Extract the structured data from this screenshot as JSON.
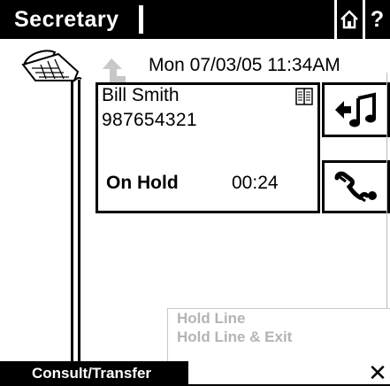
{
  "header": {
    "title": "Secretary",
    "home_icon": "home-icon",
    "help_label": "?"
  },
  "datetime": "Mon 07/03/05 11:34AM",
  "call": {
    "name": "Bill Smith",
    "number": "987654321",
    "state": "On Hold",
    "timer": "00:24",
    "directory_icon": "book-icon"
  },
  "side_buttons": [
    {
      "icon": "music-on-hold-icon"
    },
    {
      "icon": "transfer-call-icon"
    }
  ],
  "hold_menu": {
    "items": [
      "Hold Line",
      "Hold Line & Exit"
    ]
  },
  "footer": {
    "tab_label": "Consult/Transfer",
    "close_label": "✕"
  },
  "colors": {
    "header_bg": "#000000",
    "disabled_text": "#b4b4b4",
    "back_arrow": "#c8c8c8"
  }
}
